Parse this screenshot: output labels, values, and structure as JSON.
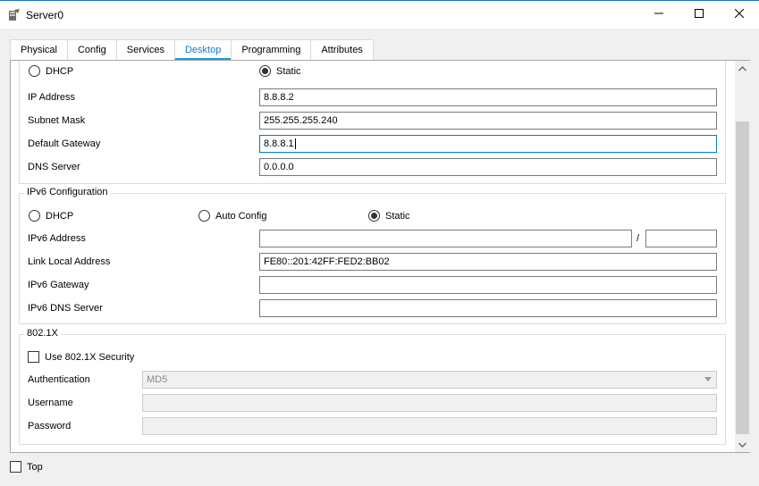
{
  "window": {
    "title": "Server0",
    "icons": {
      "app": "server-icon",
      "minimize": "minimize-icon",
      "maximize": "maximize-icon",
      "close": "close-icon"
    }
  },
  "tabs": [
    {
      "label": "Physical",
      "active": false
    },
    {
      "label": "Config",
      "active": false
    },
    {
      "label": "Services",
      "active": false
    },
    {
      "label": "Desktop",
      "active": true
    },
    {
      "label": "Programming",
      "active": false
    },
    {
      "label": "Attributes",
      "active": false
    }
  ],
  "ipv4": {
    "mode_options": {
      "dhcp": "DHCP",
      "static": "Static"
    },
    "selected_mode": "Static",
    "ip_address": {
      "label": "IP Address",
      "value": "8.8.8.2"
    },
    "subnet_mask": {
      "label": "Subnet Mask",
      "value": "255.255.255.240"
    },
    "default_gateway": {
      "label": "Default Gateway",
      "value": "8.8.8.1"
    },
    "dns_server": {
      "label": "DNS Server",
      "value": "0.0.0.0"
    }
  },
  "ipv6": {
    "legend": "IPv6 Configuration",
    "mode_options": {
      "dhcp": "DHCP",
      "auto": "Auto Config",
      "static": "Static"
    },
    "selected_mode": "Static",
    "address": {
      "label": "IPv6 Address",
      "value": "",
      "prefix": "",
      "separator": "/"
    },
    "link_local": {
      "label": "Link Local Address",
      "value": "FE80::201:42FF:FED2:BB02"
    },
    "gateway": {
      "label": "IPv6 Gateway",
      "value": ""
    },
    "dns_server": {
      "label": "IPv6 DNS Server",
      "value": ""
    }
  },
  "dot1x": {
    "legend": "802.1X",
    "use_security": {
      "label": "Use 802.1X Security",
      "checked": false
    },
    "authentication": {
      "label": "Authentication",
      "value": "MD5"
    },
    "username": {
      "label": "Username",
      "value": ""
    },
    "password": {
      "label": "Password",
      "value": ""
    }
  },
  "footer": {
    "top": {
      "label": "Top",
      "checked": false
    }
  },
  "colors": {
    "accent": "#1a9ad6",
    "focus_border": "#0078d7",
    "titlebar_border": "#1a73c9"
  }
}
